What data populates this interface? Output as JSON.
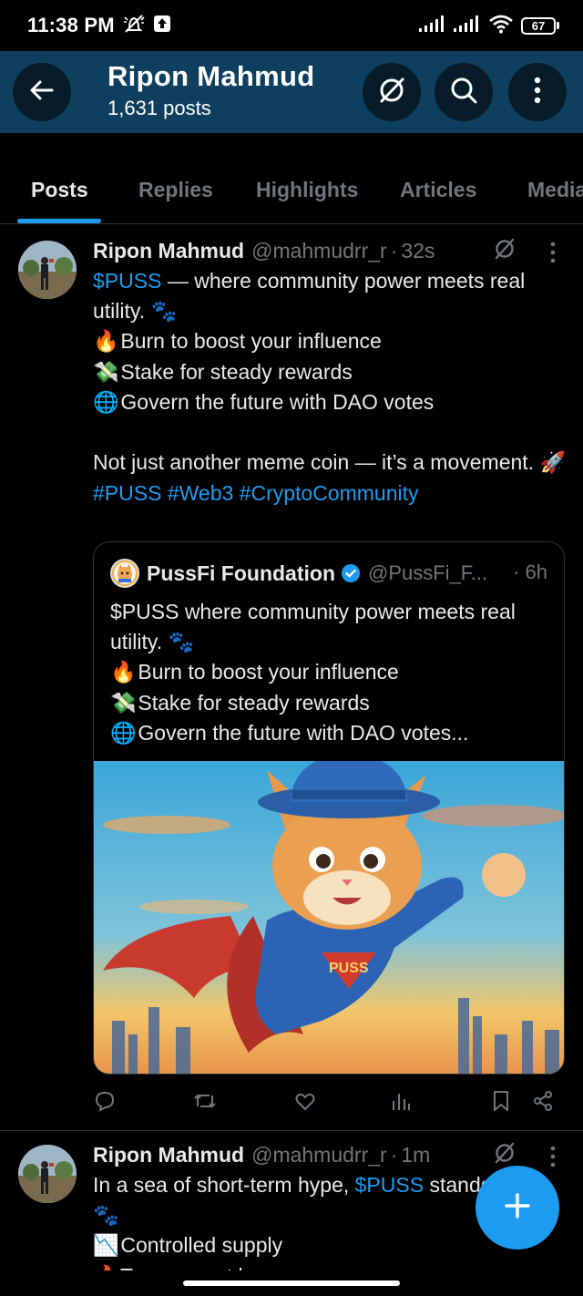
{
  "status_bar": {
    "time": "11:38 PM",
    "battery": "67",
    "icons": [
      "mute-icon",
      "upload-notification-icon",
      "signal-icon",
      "signal-icon",
      "wifi-icon",
      "battery-icon"
    ]
  },
  "header": {
    "title": "Ripon Mahmud",
    "subtitle": "1,631 posts",
    "icons": [
      "back-arrow-icon",
      "grok-icon",
      "search-icon",
      "more-vertical-icon"
    ],
    "background": "#0f3f5e"
  },
  "tabs": [
    {
      "label": "Posts",
      "active": true
    },
    {
      "label": "Replies",
      "active": false
    },
    {
      "label": "Highlights",
      "active": false
    },
    {
      "label": "Articles",
      "active": false
    },
    {
      "label": "Media",
      "active": false
    }
  ],
  "post1": {
    "author": "Ripon Mahmud",
    "handle": "@mahmudrr_r",
    "dot": "·",
    "ago": "32s",
    "line1_link": "$PUSS",
    "line1_rest": " — where community power meets real utility.",
    "paw": "🐾",
    "bullets": [
      {
        "emoji": "🔥",
        "text": "Burn to boost your influence"
      },
      {
        "emoji": "💸",
        "text": "Stake for steady rewards"
      },
      {
        "emoji": "🌐",
        "text": "Govern the future with DAO votes"
      }
    ],
    "closing": "Not just another meme coin — it’s a movement.",
    "rocket": "🚀",
    "hashtags": "#PUSS #Web3 #CryptoCommunity"
  },
  "quote": {
    "author": "PussFi Foundation",
    "handle": "@PussFi_F...",
    "ago": "· 6h",
    "line1": "$PUSS where community power meets real utility.",
    "paw": "🐾",
    "bullets": [
      {
        "emoji": "🔥",
        "text": "Burn to boost your influence"
      },
      {
        "emoji": "💸",
        "text": "Stake for steady rewards"
      },
      {
        "emoji": "🌐",
        "text": "Govern the future with DAO votes..."
      }
    ],
    "image_label": "PUSS"
  },
  "actions": [
    "reply-icon",
    "repost-icon",
    "like-icon",
    "views-icon",
    "bookmark-icon",
    "share-icon"
  ],
  "post2": {
    "author": "Ripon Mahmud",
    "handle": "@mahmudrr_r",
    "dot": "·",
    "ago": "1m",
    "line1_pre": "In a sea of short-term hype, ",
    "line1_link": "$PUSS",
    "line1_rest": " stands apart.",
    "paw": "🐾",
    "bullets": [
      {
        "emoji": "📉",
        "text": "Controlled supply"
      },
      {
        "emoji": "🔥",
        "text": "Transparent burns"
      }
    ]
  },
  "accent": "#1d9bf0"
}
